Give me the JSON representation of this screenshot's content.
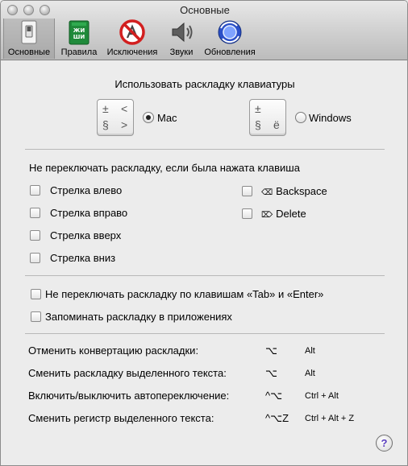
{
  "window": {
    "title": "Основные"
  },
  "toolbar": {
    "items": [
      {
        "label": "Основные",
        "icon": "switch-icon",
        "selected": true
      },
      {
        "label": "Правила",
        "icon": "book-icon",
        "selected": false
      },
      {
        "label": "Исключения",
        "icon": "no-appstore-icon",
        "selected": false
      },
      {
        "label": "Звуки",
        "icon": "speaker-icon",
        "selected": false
      },
      {
        "label": "Обновления",
        "icon": "update-globe-icon",
        "selected": false
      }
    ]
  },
  "layout_section": {
    "heading": "Использовать раскладку клавиатуры",
    "mac_key": {
      "tl": "±",
      "tr": "<",
      "bl": "§",
      "br": ">"
    },
    "win_key": {
      "tl": "±",
      "bl": "§",
      "br": "ё"
    },
    "mac_label": "Mac",
    "windows_label": "Windows",
    "selected": "Mac"
  },
  "keys_section": {
    "heading": "Не переключать раскладку, если была нажата клавиша",
    "left": [
      {
        "label": "Стрелка влево",
        "checked": false
      },
      {
        "label": "Стрелка вправо",
        "checked": false
      },
      {
        "label": "Стрелка вверх",
        "checked": false
      },
      {
        "label": "Стрелка вниз",
        "checked": false
      }
    ],
    "right": [
      {
        "symbol": "⌫",
        "label": "Backspace",
        "checked": false
      },
      {
        "symbol": "⌦",
        "label": "Delete",
        "checked": false
      }
    ]
  },
  "options": [
    {
      "label": "Не переключать раскладку по клавишам «Tab» и «Enter»",
      "checked": false
    },
    {
      "label": "Запоминать раскладку в приложениях",
      "checked": false
    }
  ],
  "shortcuts": [
    {
      "label": "Отменить конвертацию раскладки:",
      "symbol": "⌥",
      "keys": "Alt"
    },
    {
      "label": "Сменить раскладку выделенного текста:",
      "symbol": "⌥",
      "keys": "Alt"
    },
    {
      "label": "Включить/выключить автопереключение:",
      "symbol": "^⌥",
      "keys": "Ctrl + Alt"
    },
    {
      "label": "Сменить регистр выделенного текста:",
      "symbol": "^⌥Z",
      "keys": "Ctrl + Alt + Z"
    }
  ],
  "help": {
    "label": "?"
  }
}
